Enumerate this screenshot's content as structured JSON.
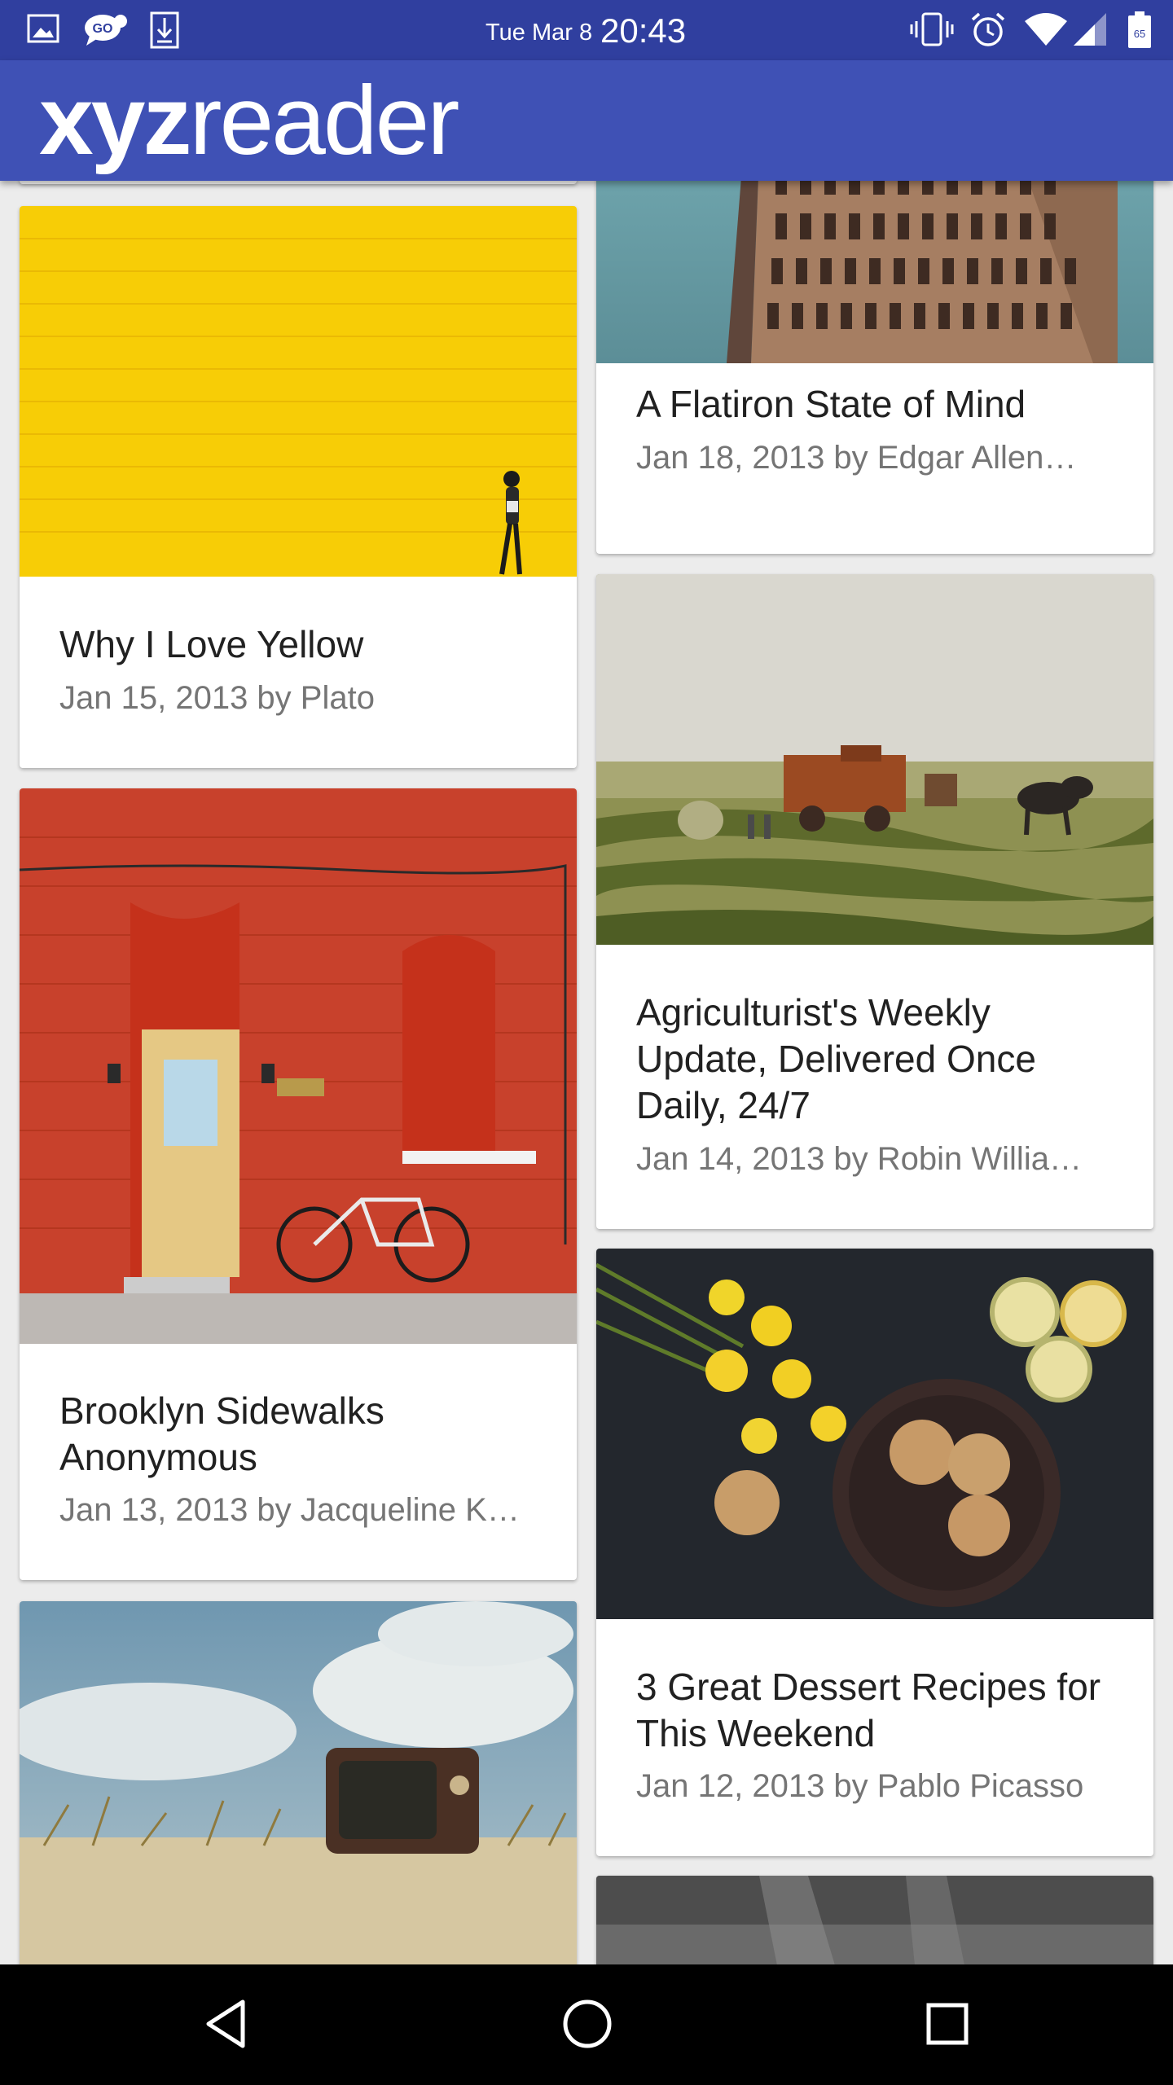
{
  "status_bar": {
    "date": "Tue Mar 8",
    "time": "20:43",
    "battery_level": "65",
    "left_icons": [
      "image-icon",
      "chat-icon",
      "download-icon"
    ],
    "right_icons": [
      "vibrate-icon",
      "alarm-icon",
      "wifi-icon",
      "signal-icon",
      "battery-icon"
    ]
  },
  "app_bar": {
    "logo_bold": "xyz",
    "logo_light": "reader",
    "color": "#3f51b5",
    "status_color": "#303f9f"
  },
  "articles": [
    {
      "title": "A Flatiron State of Mind",
      "meta": "Jan 18, 2013 by Edgar Allen…"
    },
    {
      "title": "Why I Love Yellow",
      "meta": "Jan 15, 2013 by Plato"
    },
    {
      "title": "Agriculturist's Weekly Update, Delivered Once Daily, 24/7",
      "meta": "Jan 14, 2013 by Robin Willia…"
    },
    {
      "title": "Brooklyn Sidewalks Anonymous",
      "meta": "Jan 13, 2013 by Jacqueline K…"
    },
    {
      "title": "3 Great Dessert Recipes for This Weekend",
      "meta": "Jan 12, 2013 by Pablo Picasso"
    }
  ],
  "nav_bar": {
    "buttons": [
      "back-icon",
      "home-icon",
      "recents-icon"
    ]
  }
}
